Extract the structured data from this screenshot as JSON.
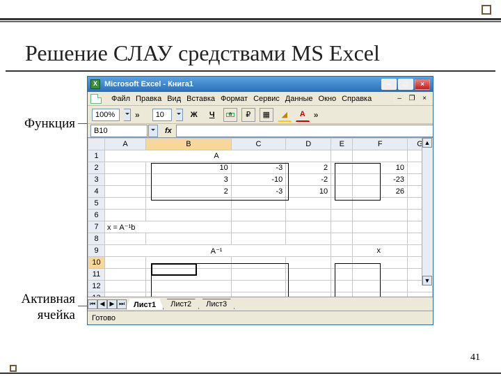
{
  "slide": {
    "title": "Решение СЛАУ средствами MS Excel",
    "page_number": "41",
    "label_function": "Функция",
    "label_active_cell": "Активная ячейка"
  },
  "window": {
    "app_title": "Microsoft Excel - Книга1",
    "menu": [
      "Файл",
      "Правка",
      "Вид",
      "Вставка",
      "Формат",
      "Сервис",
      "Данные",
      "Окно",
      "Справка"
    ],
    "toolbar": {
      "zoom": "100%",
      "font_size": "10"
    },
    "name_box": "B10",
    "fx_label": "fx",
    "columns": [
      "A",
      "B",
      "C",
      "D",
      "E",
      "F",
      "G"
    ],
    "rows": {
      "1": {
        "A": "A"
      },
      "2": {
        "B": "10",
        "C": "-3",
        "D": "2",
        "F": "10"
      },
      "3": {
        "B": "3",
        "C": "-10",
        "D": "-2",
        "F": "-23"
      },
      "4": {
        "B": "2",
        "C": "-3",
        "D": "10",
        "F": "26"
      },
      "7": {
        "A": "x = A⁻¹b"
      },
      "9": {
        "A": "A⁻¹",
        "F": "x"
      }
    },
    "tabs": [
      "Лист1",
      "Лист2",
      "Лист3"
    ],
    "status": "Готово"
  },
  "chart_data": {
    "type": "table",
    "active_cell": "B10",
    "matrix_A": [
      [
        10,
        -3,
        2
      ],
      [
        3,
        -10,
        -2
      ],
      [
        2,
        -3,
        10
      ]
    ],
    "vector_b": [
      10,
      -23,
      26
    ],
    "labels": {
      "matrix": "A",
      "equation": "x = A⁻¹b",
      "inverse": "A⁻¹",
      "result": "x"
    }
  }
}
